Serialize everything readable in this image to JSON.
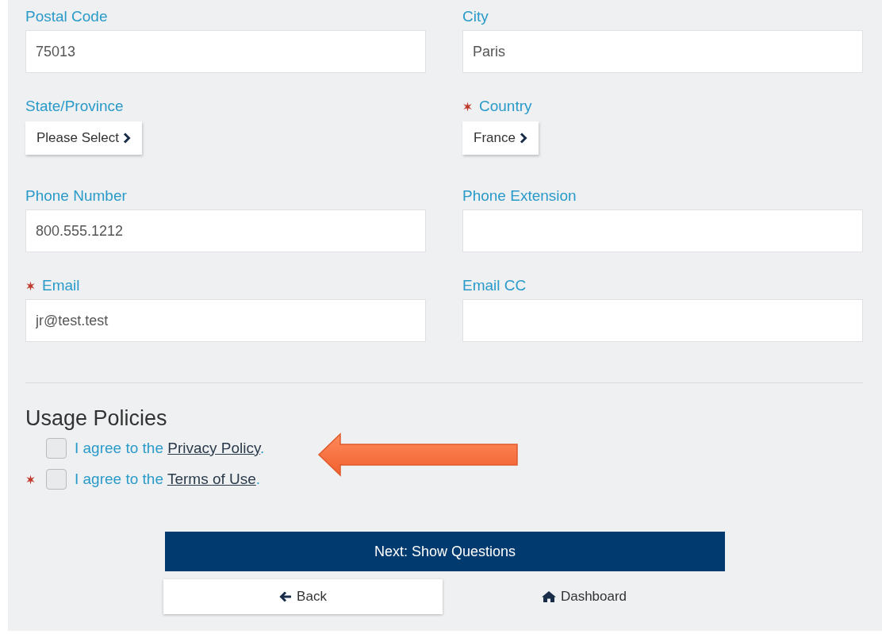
{
  "fields": [
    {
      "label": "Postal Code",
      "kind": "text",
      "value": "75013",
      "required": false
    },
    {
      "label": "City",
      "kind": "text",
      "value": "Paris",
      "required": false
    },
    {
      "label": "State/Province",
      "kind": "select",
      "value": "Please Select",
      "required": false
    },
    {
      "label": "Country",
      "kind": "select",
      "value": "France",
      "required": true
    },
    {
      "label": "Phone Number",
      "kind": "text",
      "value": "800.555.1212",
      "required": false
    },
    {
      "label": "Phone Extension",
      "kind": "text",
      "required": false
    },
    {
      "label": "Email",
      "kind": "text",
      "value": "jr@test.test",
      "required": true
    },
    {
      "label": "Email CC",
      "kind": "text",
      "required": false
    }
  ],
  "usage_policies": {
    "title": "Usage Policies",
    "items": [
      {
        "text": "I agree to the",
        "link": "Privacy Policy",
        "end": ".",
        "checked": false,
        "required": false
      },
      {
        "text": "I agree to the",
        "link": "Terms of Use",
        "end": ".",
        "checked": false,
        "required": true
      }
    ]
  },
  "next_button": "Next: Show Questions",
  "back_button": "Back",
  "dashboard_link": "Dashboard"
}
